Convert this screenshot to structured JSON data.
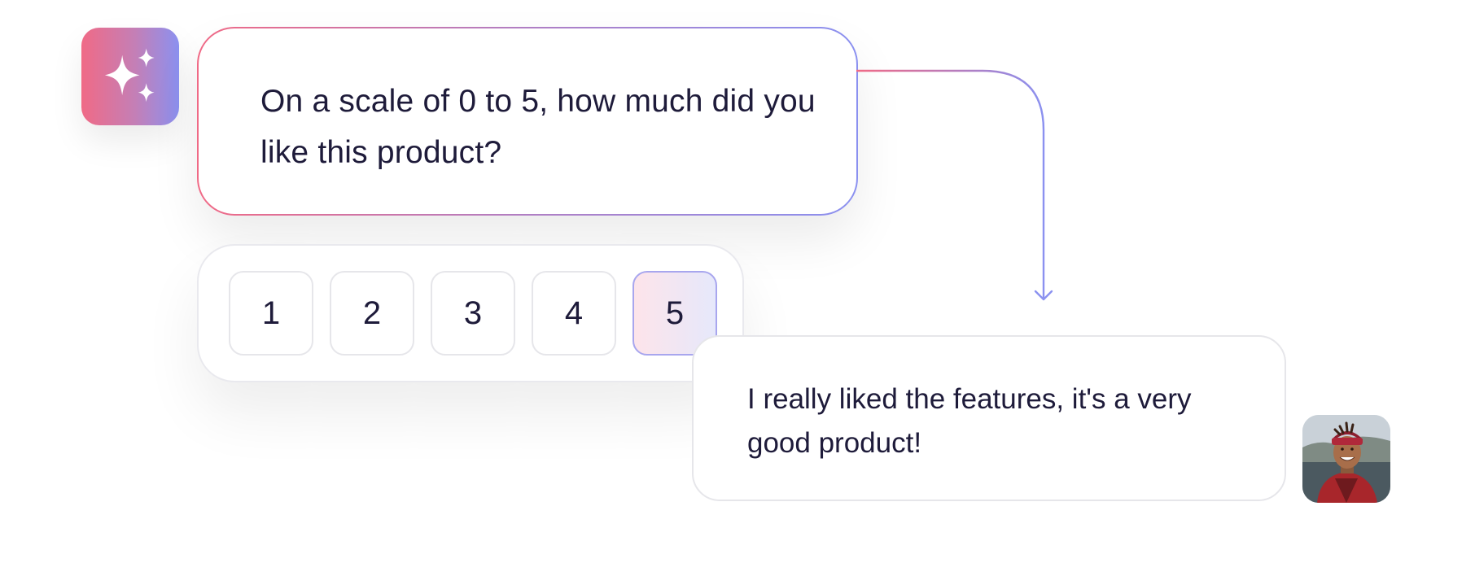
{
  "ai": {
    "icon": "sparkles-icon",
    "gradient": [
      "#f06a86",
      "#8b91f0"
    ]
  },
  "question": {
    "text": "On a scale of 0 to 5, how much did you like this product?"
  },
  "rating": {
    "options": [
      "1",
      "2",
      "3",
      "4",
      "5"
    ],
    "selected": "5"
  },
  "answer": {
    "text": "I really liked the features, it's a very good product!"
  },
  "user": {
    "icon": "user-photo-avatar"
  },
  "colors": {
    "text": "#1e1b3a",
    "accent_pink": "#f06a86",
    "accent_violet": "#8b91f0",
    "border": "#e6e6ea"
  }
}
